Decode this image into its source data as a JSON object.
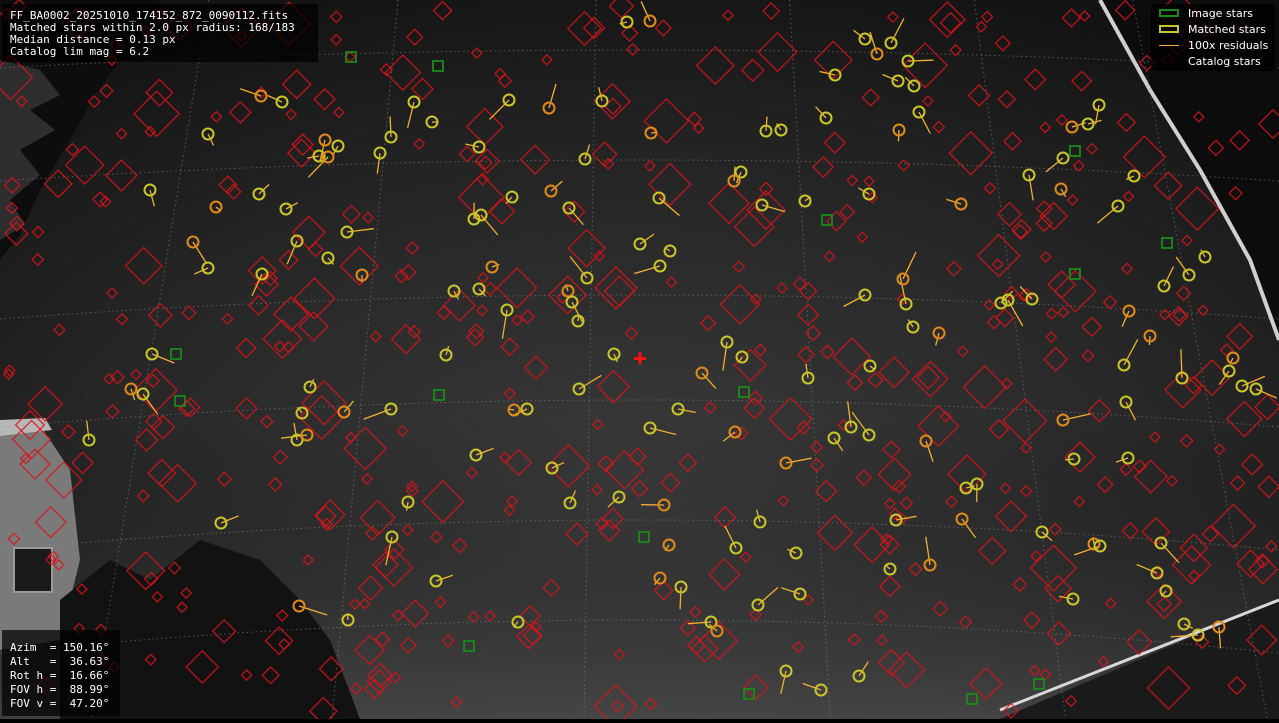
{
  "header_info": {
    "filename": "FF_BA0002_20251010_174152_872_0090112.fits",
    "matched_stars": "Matched stars within 2.0 px radius: 168/183",
    "median_distance": "Median distance = 0.13 px",
    "catalog_lim_mag": "Catalog lim mag = 6.2"
  },
  "legend": {
    "image_stars": "Image stars",
    "matched_stars": "Matched stars",
    "residuals": "100x residuals",
    "catalog_stars": "Catalog stars"
  },
  "pointing": {
    "azim": "Azim  = 150.16°",
    "alt": "Alt   =  36.63°",
    "rot_h": "Rot h =  16.66°",
    "fov_h": "FOV h =  88.99°",
    "fov_v": "FOV v =  47.20°"
  },
  "colors": {
    "catalog_marker": "#d8141a",
    "matched_marker": "#c9c62a",
    "matched_inner": "#e08a1a",
    "residual_line": "#f0b030",
    "image_star_marker": "#1a8a1a",
    "center_cross": "#ff1010",
    "grid_line": "#8a8a8a"
  }
}
